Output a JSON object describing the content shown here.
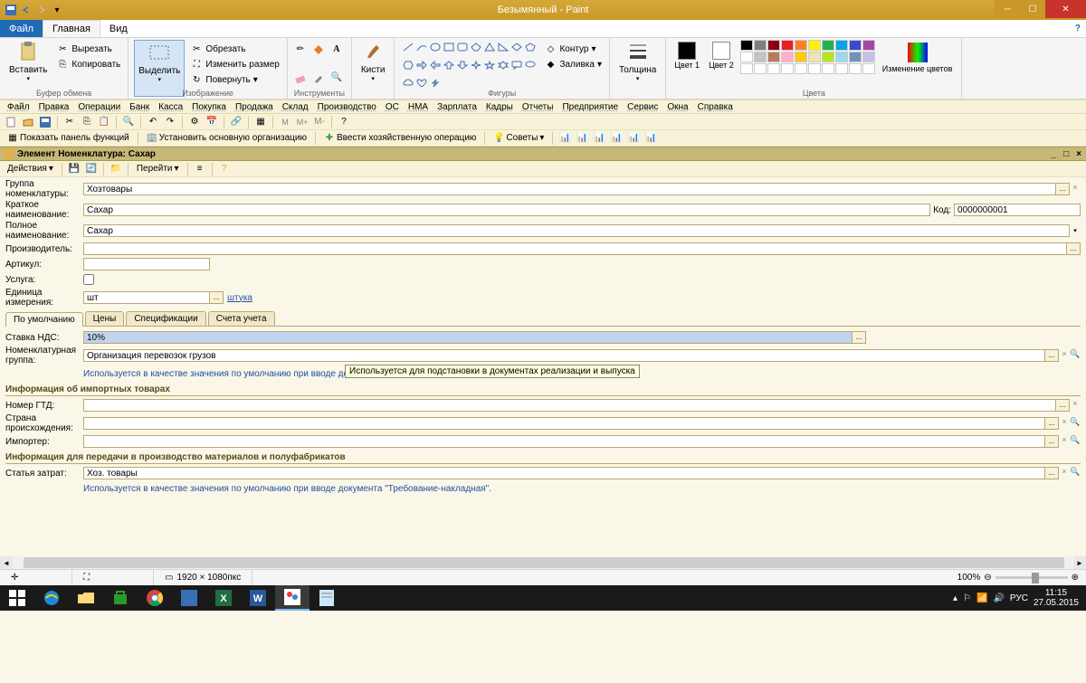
{
  "title": "Безымянный - Paint",
  "ribbon_tabs": {
    "file": "Файл",
    "home": "Главная",
    "view": "Вид"
  },
  "clipboard": {
    "paste": "Вставить",
    "cut": "Вырезать",
    "copy": "Копировать",
    "group": "Буфер обмена"
  },
  "image": {
    "select": "Выделить",
    "crop": "Обрезать",
    "resize": "Изменить размер",
    "rotate": "Повернуть",
    "group": "Изображение"
  },
  "tools": {
    "group": "Инструменты"
  },
  "brushes": {
    "label": "Кисти"
  },
  "shapes": {
    "outline": "Контур",
    "fill": "Заливка",
    "group": "Фигуры"
  },
  "size": {
    "label": "Толщина"
  },
  "colors": {
    "c1": "Цвет 1",
    "c2": "Цвет 2",
    "edit": "Изменение цветов",
    "group": "Цвета"
  },
  "palette_row1": [
    "#000000",
    "#7f7f7f",
    "#880015",
    "#ed1c24",
    "#ff7f27",
    "#fff200",
    "#22b14c",
    "#00a2e8",
    "#3f48cc",
    "#a349a4"
  ],
  "palette_row2": [
    "#ffffff",
    "#c3c3c3",
    "#b97a57",
    "#ffaec9",
    "#ffc90e",
    "#efe4b0",
    "#b5e61d",
    "#99d9ea",
    "#7092be",
    "#c8bfe7"
  ],
  "palette_row3": [
    "#ffffff",
    "#ffffff",
    "#ffffff",
    "#ffffff",
    "#ffffff",
    "#ffffff",
    "#ffffff",
    "#ffffff",
    "#ffffff",
    "#ffffff"
  ],
  "app_menu": [
    "Файл",
    "Правка",
    "Операции",
    "Банк",
    "Касса",
    "Покупка",
    "Продажа",
    "Склад",
    "Производство",
    "ОС",
    "НМА",
    "Зарплата",
    "Кадры",
    "Отчеты",
    "Предприятие",
    "Сервис",
    "Окна",
    "Справка"
  ],
  "app_tb2": {
    "show_panel": "Показать панель функций",
    "set_org": "Установить основную организацию",
    "enter_op": "Ввести хозяйственную операцию",
    "advices": "Советы"
  },
  "form": {
    "header": "Элемент Номенклатура: Сахар",
    "actions": "Действия",
    "goto": "Перейти",
    "group_label": "Группа номенклатуры:",
    "group_value": "Хозтовары",
    "short_label": "Краткое наименование:",
    "short_value": "Сахар",
    "code_label": "Код:",
    "code_value": "0000000001",
    "full_label": "Полное наименование:",
    "full_value": "Сахар",
    "manufacturer_label": "Производитель:",
    "article_label": "Артикул:",
    "service_label": "Услуга:",
    "unit_label": "Единица измерения:",
    "unit_value": "шт",
    "unit_link": "штука",
    "tabs": [
      "По умолчанию",
      "Цены",
      "Спецификации",
      "Счета учета"
    ],
    "vat_label": "Ставка НДС:",
    "vat_value": "10%",
    "nomgroup_label": "Номенклатурная группа:",
    "nomgroup_value": "Организация перевозок грузов",
    "nomgroup_hint": "Используется в качестве значения по умолчанию при вводе документов реализации и выпуска готовой продукции и услуг",
    "tooltip": "Используется для подстановки в документах реализации и выпуска",
    "import_header": "Информация об импортных товарах",
    "gtd_label": "Номер ГТД:",
    "country_label": "Страна происхождения:",
    "importer_label": "Импортер:",
    "prod_header": "Информация для передачи в производство материалов и полуфабрикатов",
    "cost_label": "Статья затрат:",
    "cost_value": "Хоз. товары",
    "cost_hint": "Используется в качестве значения по умолчанию при вводе документа \"Требование-накладная\"."
  },
  "status": {
    "dims": "1920 × 1080пкс",
    "zoom": "100%"
  },
  "tray": {
    "lang": "РУС",
    "time": "11:15",
    "date": "27.05.2015"
  }
}
